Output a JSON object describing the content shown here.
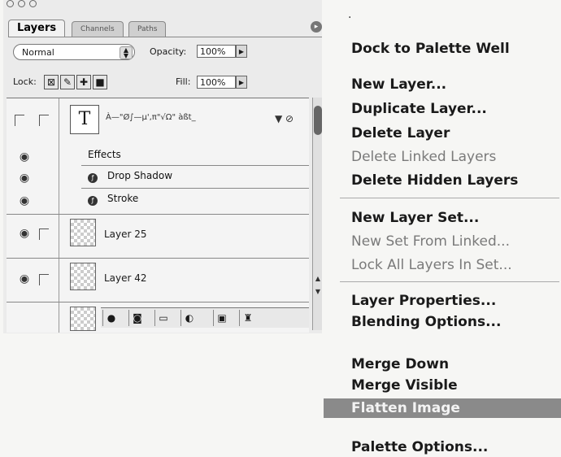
{
  "palette": {
    "tabs": [
      "Layers",
      "Channels",
      "Paths"
    ],
    "blend_mode": "Normal",
    "opacity_label": "Opacity:",
    "opacity_value": "100%",
    "lock_label": "Lock:",
    "fill_label": "Fill:",
    "fill_value": "100%",
    "text_layer_name": "À—\"Ø∫—µ',π\"√Ω\" àßt_",
    "effects_label": "Effects",
    "effects": [
      "Drop Shadow",
      "Stroke"
    ],
    "layers": [
      "Layer 25",
      "Layer 42"
    ]
  },
  "menu": {
    "items": [
      {
        "label": "Dock to Palette Well",
        "enabled": true
      },
      {
        "label": "New Layer...",
        "enabled": true
      },
      {
        "label": "Duplicate Layer...",
        "enabled": true
      },
      {
        "label": "Delete Layer",
        "enabled": true
      },
      {
        "label": "Delete Linked Layers",
        "enabled": false
      },
      {
        "label": "Delete Hidden Layers",
        "enabled": true
      },
      {
        "label": "New Layer Set...",
        "enabled": true
      },
      {
        "label": "New Set From Linked...",
        "enabled": false
      },
      {
        "label": "Lock All Layers In Set...",
        "enabled": false
      },
      {
        "label": "Layer Properties...",
        "enabled": true
      },
      {
        "label": "Blending Options...",
        "enabled": true
      },
      {
        "label": "Merge Down",
        "enabled": true
      },
      {
        "label": "Merge Visible",
        "enabled": true
      },
      {
        "label": "Flatten Image",
        "enabled": true,
        "selected": true
      },
      {
        "label": "Palette Options...",
        "enabled": true
      }
    ]
  }
}
